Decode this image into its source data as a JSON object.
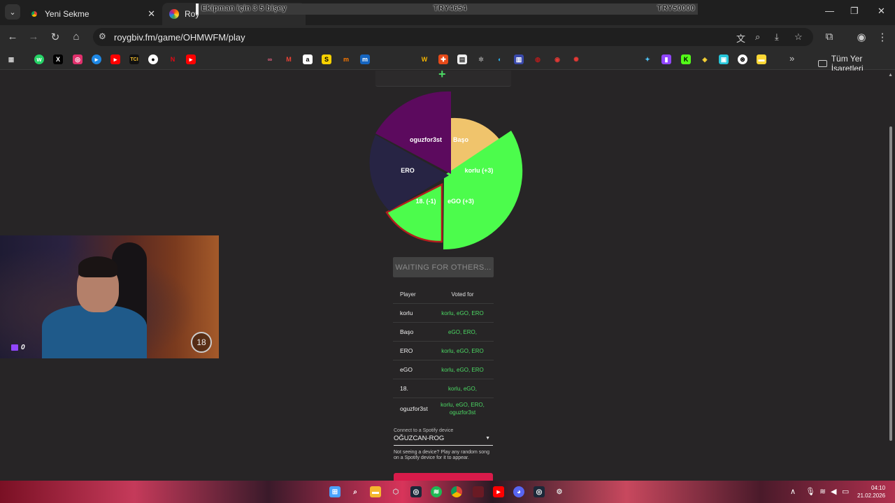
{
  "browser": {
    "tabs": [
      {
        "title": "Yeni Sekme"
      },
      {
        "title": "Roy"
      }
    ],
    "url": "roygbiv.fm/game/OHMWFM/play",
    "bookmarks_folder": "Tüm Yer İşaretleri"
  },
  "overlay": {
    "message": "Ekipman için 3 5 bişey",
    "mid_amount": "TRY4654",
    "right_amount": "TRY50000"
  },
  "game": {
    "pie_labels": [
      "oguzfor3st",
      "Başo",
      "korlu (+3)",
      "eGO (+3)",
      "18. (-1)",
      "ERO"
    ],
    "waiting_label": "WAITING FOR OTHERS...",
    "votes_table": {
      "headers": [
        "Player",
        "Voted for"
      ],
      "rows": [
        {
          "player": "korlu",
          "voted": "korlu, eGO, ERO"
        },
        {
          "player": "Başo",
          "voted": "eGO, ERO,"
        },
        {
          "player": "ERO",
          "voted": "korlu, eGO, ERO"
        },
        {
          "player": "eGO",
          "voted": "korlu, eGO, ERO"
        },
        {
          "player": "18.",
          "voted": "korlu, eGO,"
        },
        {
          "player": "oguzfor3st",
          "voted": "korlu, eGO, ERO, oguzfor3st"
        }
      ]
    },
    "spotify": {
      "caption": "Connect to a Spotify device",
      "device": "OĞUZCAN-ROG",
      "note": "Not seeing a device? Play any random song on a Spotify device for it to appear."
    }
  },
  "webcam": {
    "viewer_count": "0",
    "age_badge": "18"
  },
  "taskbar": {
    "time": "04:10",
    "date": "21.02.2026"
  },
  "colors": {
    "pie_green": "#4cfc4c",
    "pie_purple": "#5c0a5e",
    "pie_navy": "#272444",
    "pie_gold": "#f0c46c",
    "vote_green": "#4cd964",
    "accent_red": "#d81b4a"
  }
}
